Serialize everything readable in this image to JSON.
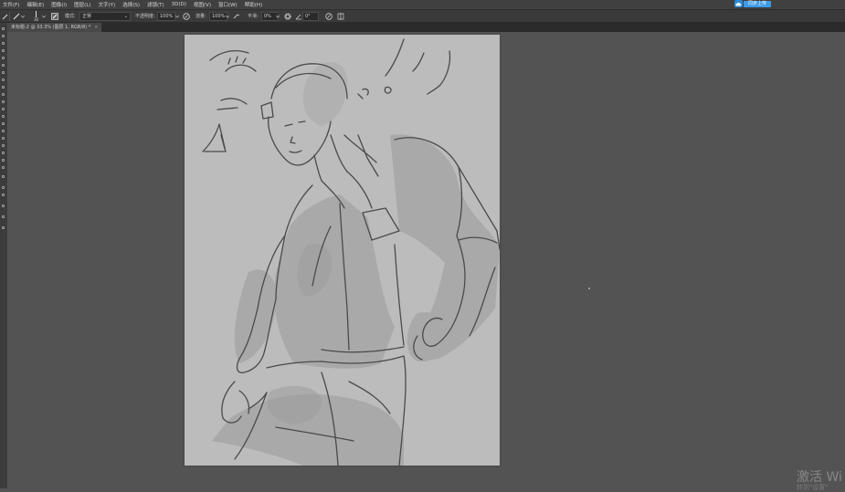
{
  "menu": {
    "items": [
      "文件(F)",
      "编辑(E)",
      "图像(I)",
      "图层(L)",
      "文字(Y)",
      "选择(S)",
      "滤镜(T)",
      "3D(D)",
      "视图(V)",
      "窗口(W)",
      "帮助(H)"
    ],
    "cloud_button_label": "同步上传"
  },
  "options": {
    "brush_size": "30",
    "mode_label": "模式:",
    "mode_value": "正常",
    "opacity_label": "不透明度:",
    "opacity_value": "100%",
    "flow_label": "流量:",
    "flow_value": "100%",
    "smooth_label": "平滑:",
    "smooth_value": "0%",
    "angle_value": "0°"
  },
  "document": {
    "tab_title": "未标题-2 @ 33.3% (图层 1, RGB/8) *",
    "close_label": "×"
  },
  "watermark": {
    "line1": "激活 Wi",
    "line2": "转到\"设置\""
  },
  "colors": {
    "canvas_bg": "#535353",
    "paper": "#bcbcbc",
    "accent": "#3d9ae8"
  }
}
